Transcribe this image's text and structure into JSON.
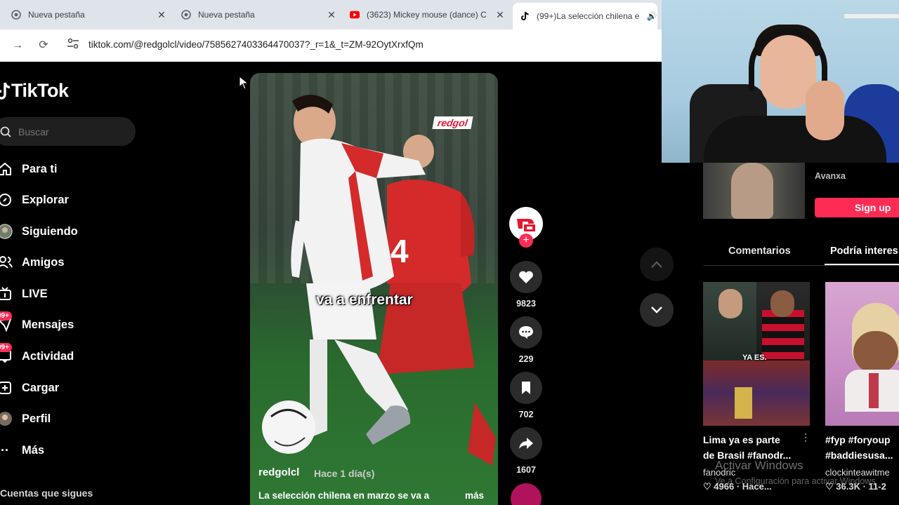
{
  "browser": {
    "tabs": [
      {
        "label": "Nueva pestaña",
        "favicon": "chrome-icon"
      },
      {
        "label": "Nueva pestaña",
        "favicon": "chrome-icon"
      },
      {
        "label": "(3623) Mickey mouse (dance) C",
        "favicon": "youtube-icon"
      },
      {
        "label": "(99+)La selección chilena e",
        "favicon": "tiktok-icon"
      }
    ],
    "url": "tiktok.com/@redgolcl/video/7585627403364470037?_r=1&_t=ZM-92OytXrxfQm"
  },
  "sidebar": {
    "logo_text": "TikTok",
    "search_placeholder": "Buscar",
    "items": [
      {
        "label": "Para ti",
        "icon": "home-icon"
      },
      {
        "label": "Explorar",
        "icon": "compass-icon"
      },
      {
        "label": "Siguiendo",
        "icon": "following-avatar-icon"
      },
      {
        "label": "Amigos",
        "icon": "friends-icon"
      },
      {
        "label": "LIVE",
        "icon": "live-icon"
      },
      {
        "label": "Mensajes",
        "icon": "messages-icon",
        "badge": "99+"
      },
      {
        "label": "Actividad",
        "icon": "activity-icon",
        "badge": "99+"
      },
      {
        "label": "Cargar",
        "icon": "upload-icon"
      },
      {
        "label": "Perfil",
        "icon": "profile-icon"
      },
      {
        "label": "Más",
        "icon": "more-icon"
      }
    ],
    "following_title": "Cuentas que sigues"
  },
  "video": {
    "overlay_caption": "va a enfrentar",
    "brand": "redgol",
    "author": "redgolcl",
    "time": "Hace 1 día(s)",
    "description": "La selección chilena en marzo se va a",
    "more": "más"
  },
  "actions": {
    "likes": "9823",
    "comments": "229",
    "saves": "702",
    "shares": "1607"
  },
  "right_panel": {
    "ad_brand": "Avanxa",
    "signup": "Sign up",
    "tabs": [
      "Comentarios",
      "Podría interes"
    ],
    "recommendations": [
      {
        "title_line1": "Lima ya es parte",
        "title_line2": "de Brasil #fanodr...",
        "author": "fanodric",
        "stats": "4966 · Hace...",
        "overlay": "YA ES."
      },
      {
        "title_line1": "#fyp #foryoup",
        "title_line2": "#baddiesusa...",
        "author": "clockinteawitme",
        "stats": "36.3K · 11-2"
      }
    ]
  },
  "watermark": {
    "line1": "Activar Windows",
    "line2": "Ve a Configuración para activar Windows"
  },
  "colors": {
    "accent": "#fe2c55",
    "background": "#000000"
  }
}
